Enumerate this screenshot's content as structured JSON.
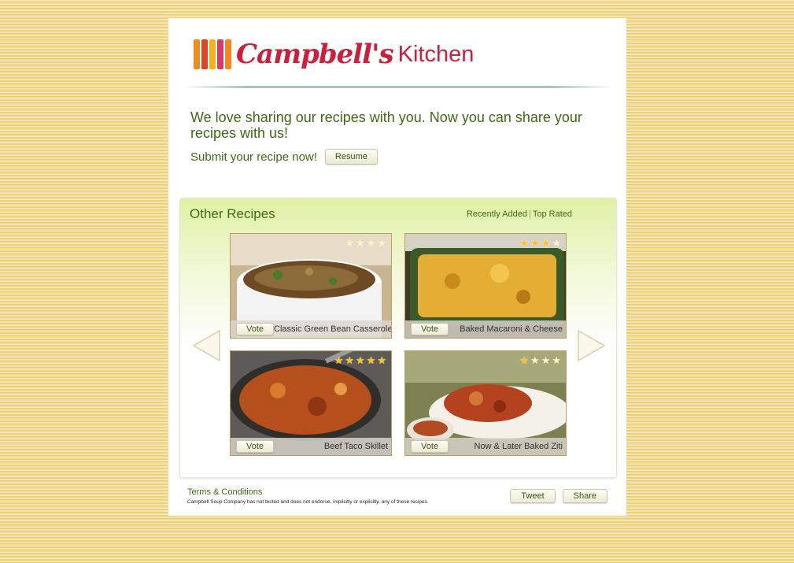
{
  "logo": {
    "script_text": "Campbell's",
    "kitchen_text": "Kitchen",
    "mark_colors": [
      "#f28c1a",
      "#e0452b",
      "#f6b21b",
      "#d43a6a",
      "#f08a20"
    ]
  },
  "intro": {
    "headline": "We love sharing our recipes with you. Now you can share your recipes with us!",
    "submit_text": "Submit your recipe now!",
    "resume_label": "Resume"
  },
  "other_recipes": {
    "title": "Other Recipes",
    "sort_links": [
      "Recently Added",
      "Top Rated"
    ],
    "prev_icon": "left-arrow-icon",
    "next_icon": "right-arrow-icon",
    "cards": [
      {
        "name": "Classic Green Bean Casserole",
        "vote_label": "Vote",
        "rating": 0,
        "max_rating": 4
      },
      {
        "name": "Baked Macaroni & Cheese",
        "vote_label": "Vote",
        "rating": 3,
        "max_rating": 4
      },
      {
        "name": "Beef Taco Skillet",
        "vote_label": "Vote",
        "rating": 5,
        "max_rating": 5
      },
      {
        "name": "Now & Later Baked Ziti",
        "vote_label": "Vote",
        "rating": 1,
        "max_rating": 4
      }
    ]
  },
  "footer": {
    "terms_label": "Terms & Conditions",
    "disclaimer": "Campbell Soup Company has not tested and does not endorse, implicitly or explicitly, any of these recipes.",
    "tweet_label": "Tweet",
    "share_label": "Share"
  },
  "colors": {
    "brand_red": "#cc1f3a",
    "text_green": "#3f6a12",
    "star_gold": "#ffc21a"
  }
}
